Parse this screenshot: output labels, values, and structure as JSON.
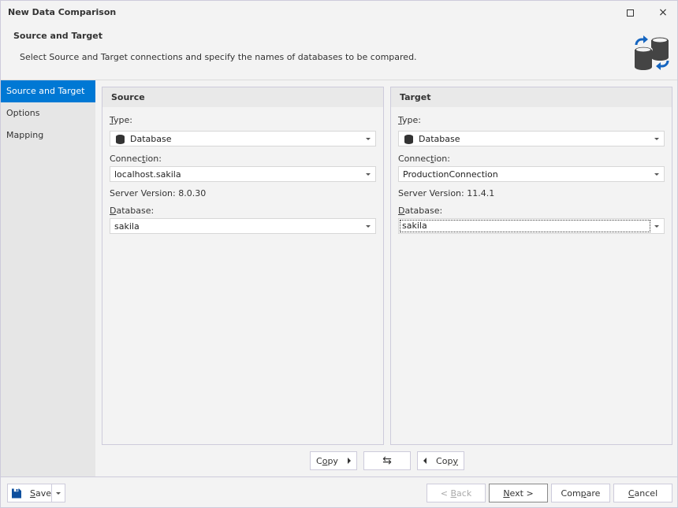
{
  "window": {
    "title": "New Data Comparison",
    "maximize_icon": "maximize-icon",
    "close_icon": "×"
  },
  "header": {
    "title": "Source and Target",
    "description": "Select Source and Target connections and specify the names of databases to be compared.",
    "icon": "data-compare-icon"
  },
  "sidebar": {
    "items": [
      {
        "label": "Source and Target",
        "active": true
      },
      {
        "label": "Options",
        "active": false
      },
      {
        "label": "Mapping",
        "active": false
      }
    ]
  },
  "source": {
    "title": "Source",
    "type_label_u": "T",
    "type_label_rest": "ype:",
    "type_value": "Database",
    "connection_label_a": "Connec",
    "connection_label_u": "t",
    "connection_label_b": "ion:",
    "connection_value": "localhost.sakila",
    "server_version": "Server Version: 8.0.30",
    "database_label_u": "D",
    "database_label_rest": "atabase:",
    "database_value": "sakila"
  },
  "target": {
    "title": "Target",
    "type_label_u": "T",
    "type_label_rest": "ype:",
    "type_value": "Database",
    "connection_label_a": "Connec",
    "connection_label_u": "t",
    "connection_label_b": "ion:",
    "connection_value": "ProductionConnection",
    "server_version": "Server Version: 11.4.1",
    "database_label_u": "D",
    "database_label_rest": "atabase:",
    "database_value": "sakila"
  },
  "copy_bar": {
    "copy_right_a": "C",
    "copy_right_u": "o",
    "copy_right_b": "py",
    "swap_icon": "⇆",
    "copy_left_a": "Cop",
    "copy_left_u": "y"
  },
  "footer": {
    "save_u": "S",
    "save_rest": "ave",
    "back_a": "< ",
    "back_u": "B",
    "back_rest": "ack",
    "next_u": "N",
    "next_rest": "ext >",
    "compare_a": "Com",
    "compare_u": "p",
    "compare_rest": "are",
    "cancel_u": "C",
    "cancel_rest": "ancel"
  }
}
